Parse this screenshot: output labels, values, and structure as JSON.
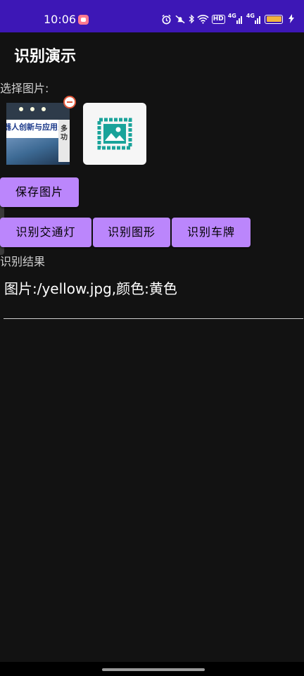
{
  "status_bar": {
    "time": "10:06",
    "icons": [
      "alarm-icon",
      "mute-icon",
      "bluetooth-icon",
      "wifi-icon",
      "hd-icon",
      "signal-4g-icon",
      "signal-4g-icon",
      "battery-icon",
      "charging-icon"
    ],
    "hd_text": "HD",
    "net1_text": "4G",
    "net2_text": "4G",
    "battery_color": "#f2b33d",
    "bar_color": "#3d17b6"
  },
  "app": {
    "title": "识别演示"
  },
  "image_picker": {
    "label": "选择图片:",
    "thumbnail_text": "器人创新与应用多用",
    "thumbnail_side_text": "多功",
    "add_icon": "image-placeholder-icon",
    "remove_icon": "remove-icon"
  },
  "buttons": {
    "save": "保存图片",
    "traffic_light": "识别交通灯",
    "shape": "识别图形",
    "plate": "识别车牌"
  },
  "result": {
    "label": "识别结果",
    "text": "图片:/yellow.jpg,颜色:黄色"
  },
  "colors": {
    "accent": "#bb86fc",
    "background": "#121212",
    "placeholder_icon": "#1aa39a"
  }
}
